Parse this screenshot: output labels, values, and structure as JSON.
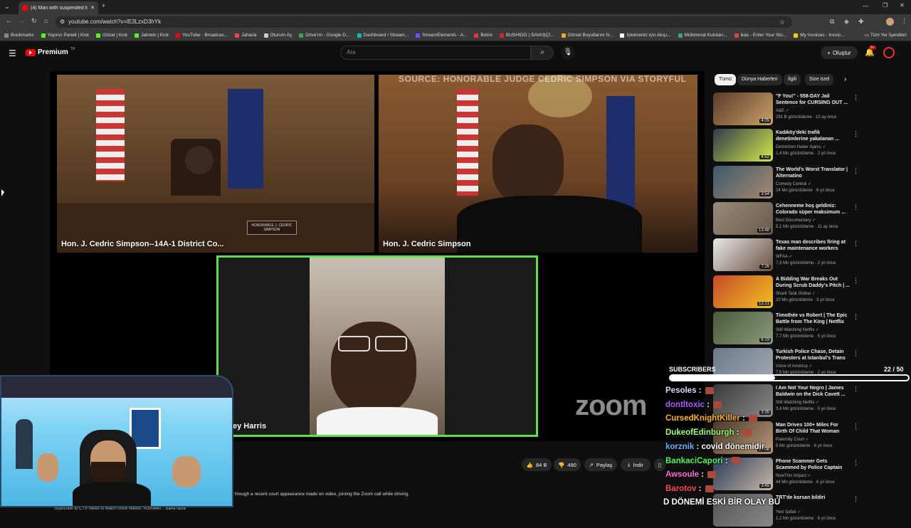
{
  "browser": {
    "tab_title": "(4) Man with suspended licence...",
    "url": "youtube.com/watch?v=lE3LzxD3hYk",
    "bookmarks": [
      {
        "label": "Bookmarks",
        "color": "#888888"
      },
      {
        "label": "Yayıncı Paneli | Kick",
        "color": "#53fc18"
      },
      {
        "label": "Gözat | Kick",
        "color": "#53fc18"
      },
      {
        "label": "Jahrein | Kick",
        "color": "#53fc18"
      },
      {
        "label": "YouTube - Broadcas...",
        "color": "#ff0000"
      },
      {
        "label": "Jaharia",
        "color": "#e44"
      },
      {
        "label": "Oturum Aç",
        "color": "#ccc"
      },
      {
        "label": "Drive'ım - Google D...",
        "color": "#34a853"
      },
      {
        "label": "Dashboard / Stream...",
        "color": "#00bfa5"
      },
      {
        "label": "StreamElements - A...",
        "color": "#7e4cff"
      },
      {
        "label": "Botrix",
        "color": "#e33"
      },
      {
        "label": "BUSHIDO | SAVAŞÇI...",
        "color": "#d22"
      },
      {
        "label": "Görsel Boyutlarını N...",
        "color": "#f5a623"
      },
      {
        "label": "İşletmeniz için Akışı...",
        "color": "#fff"
      },
      {
        "label": "Mühimmat Kutuları...",
        "color": "#3a7"
      },
      {
        "label": "ikas - Enter Your Sto...",
        "color": "#d44"
      },
      {
        "label": "My Invoices - Invoic...",
        "color": "#fc0"
      }
    ],
    "all_bookmarks": "Tüm Yer İşaretleri"
  },
  "youtube": {
    "logo": "Premium",
    "logo_suffix": "TR",
    "search_placeholder": "Ara",
    "create_label": "Oluştur",
    "notif_count": "9+"
  },
  "video": {
    "source_text": "SOURCE: HONORABLE JUDGE CEDRIC SIMPSON VIA STORYFUL",
    "tile1_label": "Hon. J. Cedric Simpson--14A-1 District Co...",
    "tile2_label": "Hon. J. Cedric Simpson",
    "tile3_label": "ey Harris",
    "plaque": "HONORABLE J. CEDRIC SIMPSON",
    "zoom": "zoom"
  },
  "actions": {
    "like": "84 B",
    "dislike": "490",
    "share": "Paylaş",
    "download": "İndir"
  },
  "description": "hrough a recent court appearance made on video, joining the Zoom call while driving.",
  "description2": "Subscribe to CTV News to watch more videos:   #ctvnews  ...daha fazla",
  "chips": [
    "Tümü",
    "Dünya Haberleri",
    "İlgili",
    "Size özel"
  ],
  "recs": [
    {
      "title": "\"F You!\" - 558-DAY Jail Sentence for CURSING OUT ...",
      "channel": "A&E",
      "meta": "291 B görüntüleme · 10 ay önce",
      "dur": "4:05",
      "c1": "#5b3b2a",
      "c2": "#c8a068"
    },
    {
      "title": "Kadıköy'deki trafik denetimlerine yakalanan ...",
      "channel": "Demirören Haber Ajansı",
      "meta": "1,4 Mn görüntüleme · 2 yıl önce",
      "dur": "4:52",
      "c1": "#2d3b4a",
      "c2": "#d4e84a"
    },
    {
      "title": "The World's Worst Translator | Alternatino",
      "channel": "Comedy Central",
      "meta": "24 Mn görüntüleme · 6 yıl önce",
      "dur": "3:54",
      "c1": "#3c5a6a",
      "c2": "#a88870"
    },
    {
      "title": "Cehenneme hoş geldiniz: Colorado süper maksimum ...",
      "channel": "Best Documentary",
      "meta": "5,1 Mn görüntüleme · 11 ay önce",
      "dur": "13:48",
      "c1": "#9a8a7a",
      "c2": "#6a5a4a"
    },
    {
      "title": "Texas man describes firing at fake maintenance workers wh...",
      "channel": "WFAA",
      "meta": "7,3 Mn görüntüleme · 2 yıl önce",
      "dur": "7:26",
      "c1": "#e8e8e8",
      "c2": "#6a5040"
    },
    {
      "title": "A Bidding War Breaks Out During Scrub Daddy's Pitch | ...",
      "channel": "Shark Tank Global",
      "meta": "20 Mn görüntüleme · 3 yıl önce",
      "dur": "12:21",
      "c1": "#c84a2a",
      "c2": "#f0c020"
    },
    {
      "title": "Timothée vs Robert | The Epic Battle from The King | Netflix",
      "channel": "Still Watching Netflix",
      "meta": "7,7 Mn görüntüleme · 5 yıl önce",
      "dur": "6:19",
      "c1": "#4a5a3a",
      "c2": "#8a9a7a"
    },
    {
      "title": "Turkish Police Chase, Detain Protesters at Istanbul's Trans ...",
      "channel": "Voice of America",
      "meta": "7,5 Mn görüntüleme · 2 yıl önce",
      "dur": "",
      "c1": "#6a7a8a",
      "c2": "#a0a8b0"
    },
    {
      "title": "I Am Not Your Negro | James Baldwin on the Dick Cavett ...",
      "channel": "Still Watching Netflix",
      "meta": "3,4 Mn görüntüleme · 5 yıl önce",
      "dur": "3:35",
      "c1": "#3a3a3a",
      "c2": "#8a8a8a"
    },
    {
      "title": "Man Drives 100+ Miles For Birth Of Child That Woman Says Isn'...",
      "channel": "Paternity Court",
      "meta": "5 Mn görüntüleme · 6 yıl önce",
      "dur": "17:08",
      "c1": "#4a3a2a",
      "c2": "#b89878"
    },
    {
      "title": "Phone Scammer Gets Scammed by Police Captain",
      "channel": "NowThis Impact",
      "meta": "44 Mn görüntüleme · 6 yıl önce",
      "dur": "3:45",
      "c1": "#2a3a5a",
      "c2": "#c8b8a8"
    },
    {
      "title": "TRT'de korsan bildiri",
      "channel": "Yeni Şafak",
      "meta": "1,2 Mn görüntüleme · 8 yıl önce",
      "dur": "",
      "c1": "#555",
      "c2": "#888"
    }
  ],
  "chat": {
    "subs_label": "SUBSCRIBERS",
    "subs_count": "22 / 50",
    "subs_fraction": 0.44,
    "lines": [
      {
        "user": "Pesoles",
        "color": "#d6d6ff",
        "msg": ""
      },
      {
        "user": "dontltoxic",
        "color": "#b05cff",
        "msg": ""
      },
      {
        "user": "CursedKnightKiller",
        "color": "#ffb31a",
        "msg": ""
      },
      {
        "user": "DukeofEdinburgh",
        "color": "#9cff6e",
        "msg": ""
      },
      {
        "user": "korznik",
        "color": "#6ab0ff",
        "msg": "covid dönemidir"
      },
      {
        "user": "BankaciCapori",
        "color": "#4cff5a",
        "msg": ""
      },
      {
        "user": "Awsoule",
        "color": "#ff6bd6",
        "msg": ""
      },
      {
        "user": "Barotov",
        "color": "#ff4d4d",
        "msg": ""
      }
    ],
    "last_line": "D DÖNEMİ ESKİ BİR OLAY BU"
  }
}
